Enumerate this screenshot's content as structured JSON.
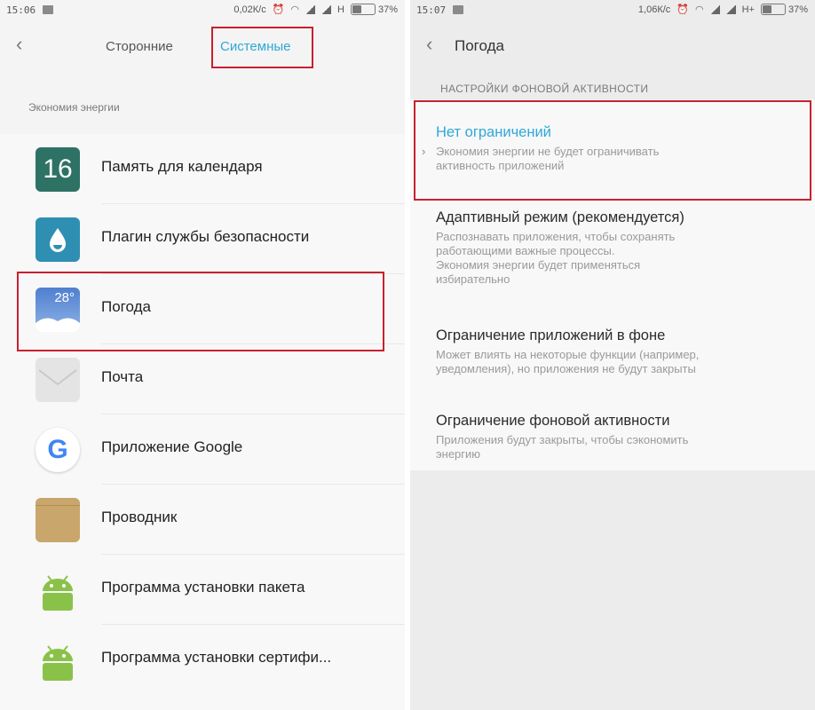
{
  "left": {
    "status": {
      "time": "15:06",
      "speed": "0,02К/c",
      "network": "H",
      "battery": "37%",
      "battery_level": 0.37
    },
    "tabs": {
      "back_glyph": "‹",
      "third_party": "Сторонние",
      "system": "Системные"
    },
    "section": "Экономия энергии",
    "apps": [
      {
        "label": "Память для календаря",
        "icon": "calendar-icon",
        "icon_text": "16"
      },
      {
        "label": "Плагин службы безопасности",
        "icon": "security-plugin-icon"
      },
      {
        "label": "Погода",
        "icon": "weather-icon",
        "icon_text": "28°"
      },
      {
        "label": "Почта",
        "icon": "mail-icon"
      },
      {
        "label": "Приложение Google",
        "icon": "google-icon",
        "icon_text": "G"
      },
      {
        "label": "Проводник",
        "icon": "file-explorer-icon"
      },
      {
        "label": "Программа установки пакета",
        "icon": "android-icon"
      },
      {
        "label": "Программа установки сертифи...",
        "icon": "android-icon"
      }
    ]
  },
  "right": {
    "status": {
      "time": "15:07",
      "speed": "1,06К/c",
      "network": "H+",
      "battery": "37%",
      "battery_level": 0.37
    },
    "header": {
      "back_glyph": "‹",
      "title": "Погода"
    },
    "section": "НАСТРОЙКИ ФОНОВОЙ АКТИВНОСТИ",
    "selected_marker": "›",
    "options": [
      {
        "title": "Нет ограничений",
        "desc": [
          "Экономия энергии не будет ограничивать",
          "активность приложений"
        ],
        "selected": true
      },
      {
        "title": "Адаптивный режим (рекомендуется)",
        "desc": [
          "Распознавать приложения, чтобы сохранять",
          "работающими важные процессы.",
          "Экономия энергии будет применяться",
          "избирательно"
        ],
        "selected": false
      },
      {
        "title": "Ограничение приложений в фоне",
        "desc": [
          "Может влиять на некоторые функции (например,",
          "уведомления), но приложения не будут закрыты"
        ],
        "selected": false
      },
      {
        "title": "Ограничение фоновой активности",
        "desc": [
          "Приложения будут закрыты, чтобы сэкономить",
          "энергию"
        ],
        "selected": false
      }
    ]
  },
  "colors": {
    "accent": "#2fa8d6",
    "highlight": "#c8202f"
  }
}
